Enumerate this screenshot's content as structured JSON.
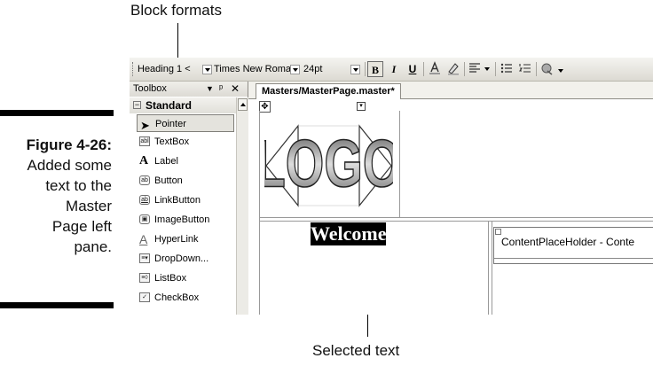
{
  "callouts": {
    "top": "Block formats",
    "bottom": "Selected text"
  },
  "caption": {
    "figure": "Figure 4-26:",
    "lines": [
      "Added some",
      "text to the",
      "Master",
      "Page left",
      "pane."
    ]
  },
  "toolbar": {
    "block_format": "Heading 1 <",
    "font_name": "Times New Roman",
    "font_size": "24pt",
    "bold": "B",
    "italic": "I",
    "underline": "U"
  },
  "toolbox": {
    "title": "Toolbox",
    "pin": "↓ `",
    "close": "✕",
    "group": "Standard",
    "items": [
      {
        "label": "Pointer",
        "icon": "pointer-icon"
      },
      {
        "label": "TextBox",
        "icon": "textbox-icon"
      },
      {
        "label": "Label",
        "icon": "label-icon"
      },
      {
        "label": "Button",
        "icon": "button-icon"
      },
      {
        "label": "LinkButton",
        "icon": "linkbutton-icon"
      },
      {
        "label": "ImageButton",
        "icon": "imagebutton-icon"
      },
      {
        "label": "HyperLink",
        "icon": "hyperlink-icon"
      },
      {
        "label": "DropDown...",
        "icon": "dropdown-icon"
      },
      {
        "label": "ListBox",
        "icon": "listbox-icon"
      },
      {
        "label": "CheckBox",
        "icon": "checkbox-icon"
      }
    ]
  },
  "document": {
    "tab": "Masters/MasterPage.master*",
    "logo_text": "LOGO",
    "welcome": "Welcome",
    "content_placeholder": "ContentPlaceHolder - Conte"
  }
}
